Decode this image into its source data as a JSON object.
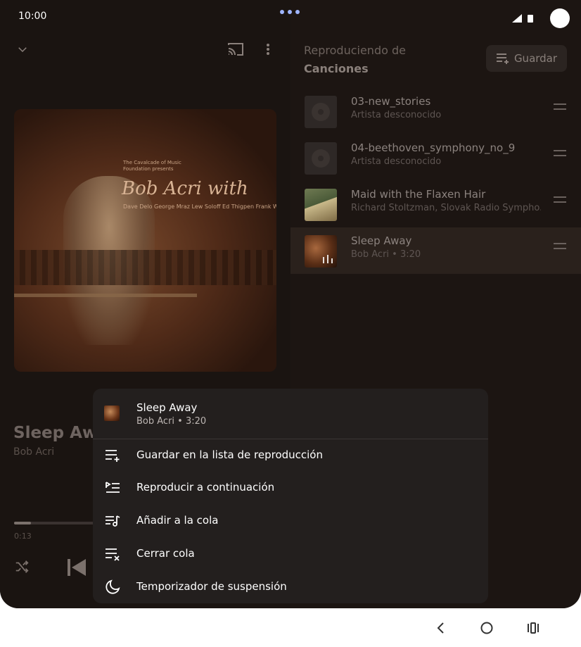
{
  "status_bar": {
    "time": "10:00"
  },
  "player": {
    "album_art_text": {
      "line1": "The Cavalcade of Music Foundation presents",
      "name": "Bob Acri with",
      "players": "Dave Delo George Mraz Lew Soloff Ed Thigpen Frank Wess"
    },
    "song_title": "Sleep Awa",
    "artist": "Bob Acri",
    "elapsed": "0:13",
    "progress_fraction": 0.066
  },
  "queue": {
    "header_label": "Reproduciendo de",
    "source": "Canciones",
    "save_label": "Guardar",
    "items": [
      {
        "title": "03-new_stories",
        "subtitle": "Artista desconocido"
      },
      {
        "title": "04-beethoven_symphony_no_9",
        "subtitle": "Artista desconocido"
      },
      {
        "title": "Maid with the Flaxen Hair",
        "subtitle": "Richard Stoltzman, Slovak Radio Sympho..."
      },
      {
        "title": "Sleep Away",
        "subtitle": "Bob Acri • 3:20"
      }
    ]
  },
  "menu": {
    "title": "Sleep Away",
    "subtitle": "Bob Acri • 3:20",
    "items": [
      {
        "label": "Guardar en la lista de reproducción",
        "icon": "playlist-add-icon"
      },
      {
        "label": "Reproducir a continuación",
        "icon": "play-next-icon"
      },
      {
        "label": "Añadir a la cola",
        "icon": "queue-music-icon"
      },
      {
        "label": "Cerrar cola",
        "icon": "playlist-remove-icon"
      },
      {
        "label": "Temporizador de suspensión",
        "icon": "moon-icon"
      }
    ]
  }
}
